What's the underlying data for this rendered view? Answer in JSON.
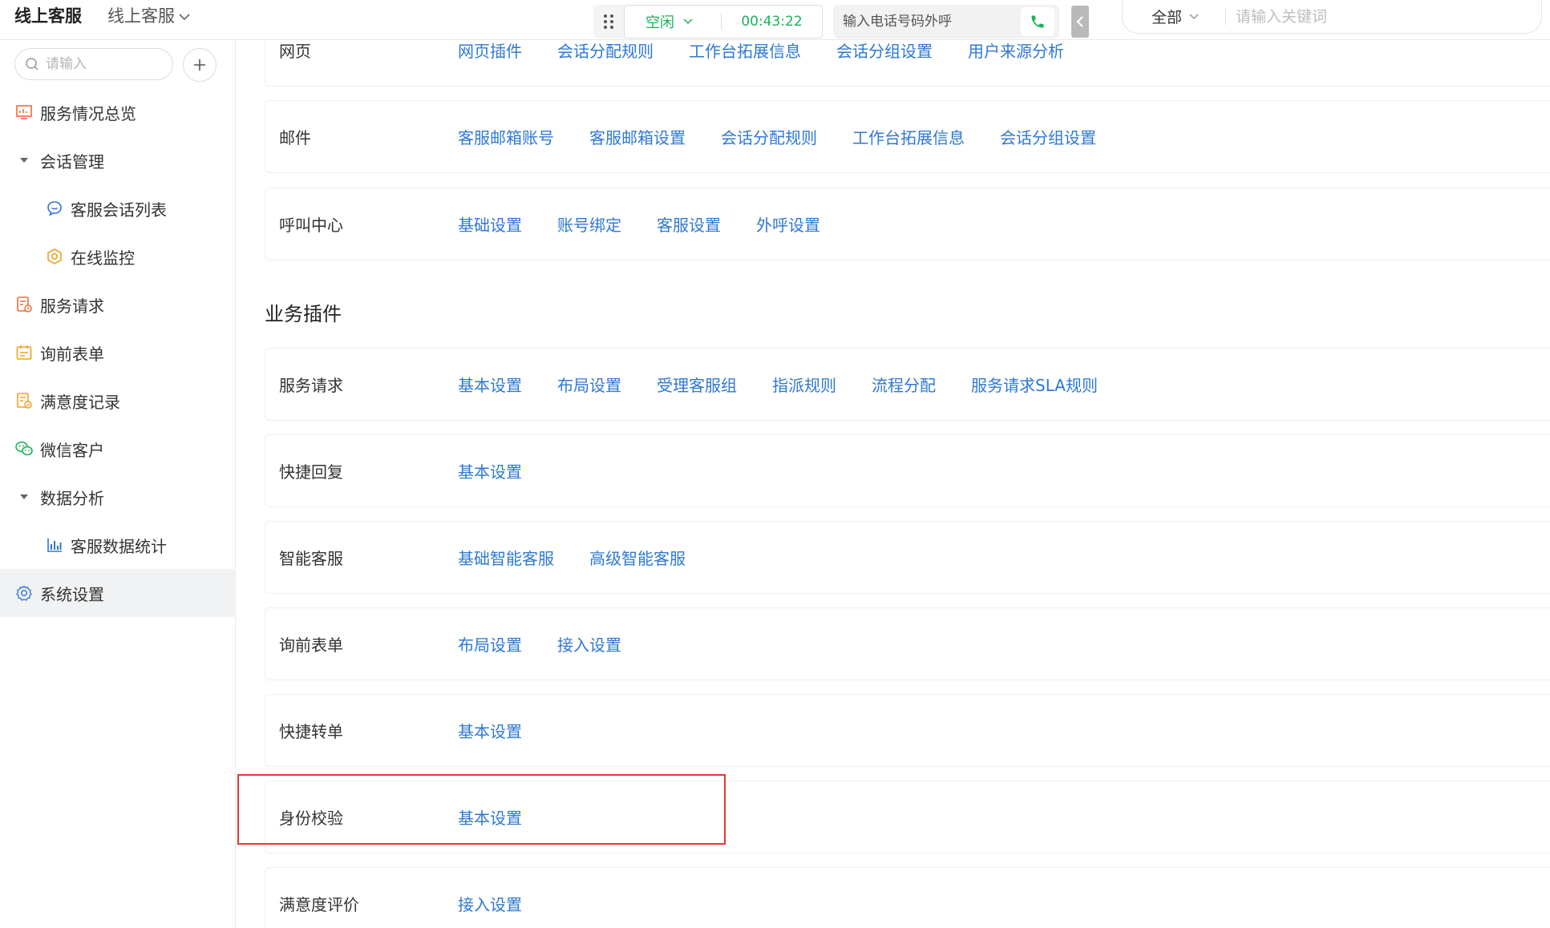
{
  "topbar": {
    "app_title": "线上客服",
    "app_switcher_label": "线上客服",
    "status": "空闲",
    "timer": "00:43:22",
    "dial_placeholder": "输入电话号码外呼",
    "search_scope": "全部",
    "search_placeholder": "请输入关键词",
    "accent_green": "#1bb25a"
  },
  "sidebar": {
    "search_placeholder": "请输入",
    "items": [
      {
        "label": "服务情况总览",
        "icon": "dashboard-icon"
      },
      {
        "label": "会话管理",
        "icon": "caret-down-icon"
      },
      {
        "label": "客服会话列表",
        "icon": "chat-icon"
      },
      {
        "label": "在线监控",
        "icon": "monitor-icon"
      },
      {
        "label": "服务请求",
        "icon": "service-request-icon"
      },
      {
        "label": "询前表单",
        "icon": "form-icon"
      },
      {
        "label": "满意度记录",
        "icon": "satisfaction-icon"
      },
      {
        "label": "微信客户",
        "icon": "wechat-icon"
      },
      {
        "label": "数据分析",
        "icon": "caret-down-icon"
      },
      {
        "label": "客服数据统计",
        "icon": "bar-chart-icon"
      },
      {
        "label": "系统设置",
        "icon": "gear-icon"
      }
    ]
  },
  "main": {
    "channel_rows": [
      {
        "label": "网页",
        "links": [
          "网页插件",
          "会话分配规则",
          "工作台拓展信息",
          "会话分组设置",
          "用户来源分析"
        ]
      },
      {
        "label": "邮件",
        "links": [
          "客服邮箱账号",
          "客服邮箱设置",
          "会话分配规则",
          "工作台拓展信息",
          "会话分组设置"
        ]
      },
      {
        "label": "呼叫中心",
        "links": [
          "基础设置",
          "账号绑定",
          "客服设置",
          "外呼设置"
        ]
      }
    ],
    "section_title": "业务插件",
    "plugin_rows": [
      {
        "label": "服务请求",
        "links": [
          "基本设置",
          "布局设置",
          "受理客服组",
          "指派规则",
          "流程分配",
          "服务请求SLA规则"
        ]
      },
      {
        "label": "快捷回复",
        "links": [
          "基本设置"
        ]
      },
      {
        "label": "智能客服",
        "links": [
          "基础智能客服",
          "高级智能客服"
        ]
      },
      {
        "label": "询前表单",
        "links": [
          "布局设置",
          "接入设置"
        ]
      },
      {
        "label": "快捷转单",
        "links": [
          "基本设置"
        ]
      },
      {
        "label": "身份校验",
        "links": [
          "基本设置"
        ]
      },
      {
        "label": "满意度评价",
        "links": [
          "接入设置"
        ]
      }
    ],
    "link_color": "#2e78d4",
    "highlight_color": "#e53935"
  }
}
